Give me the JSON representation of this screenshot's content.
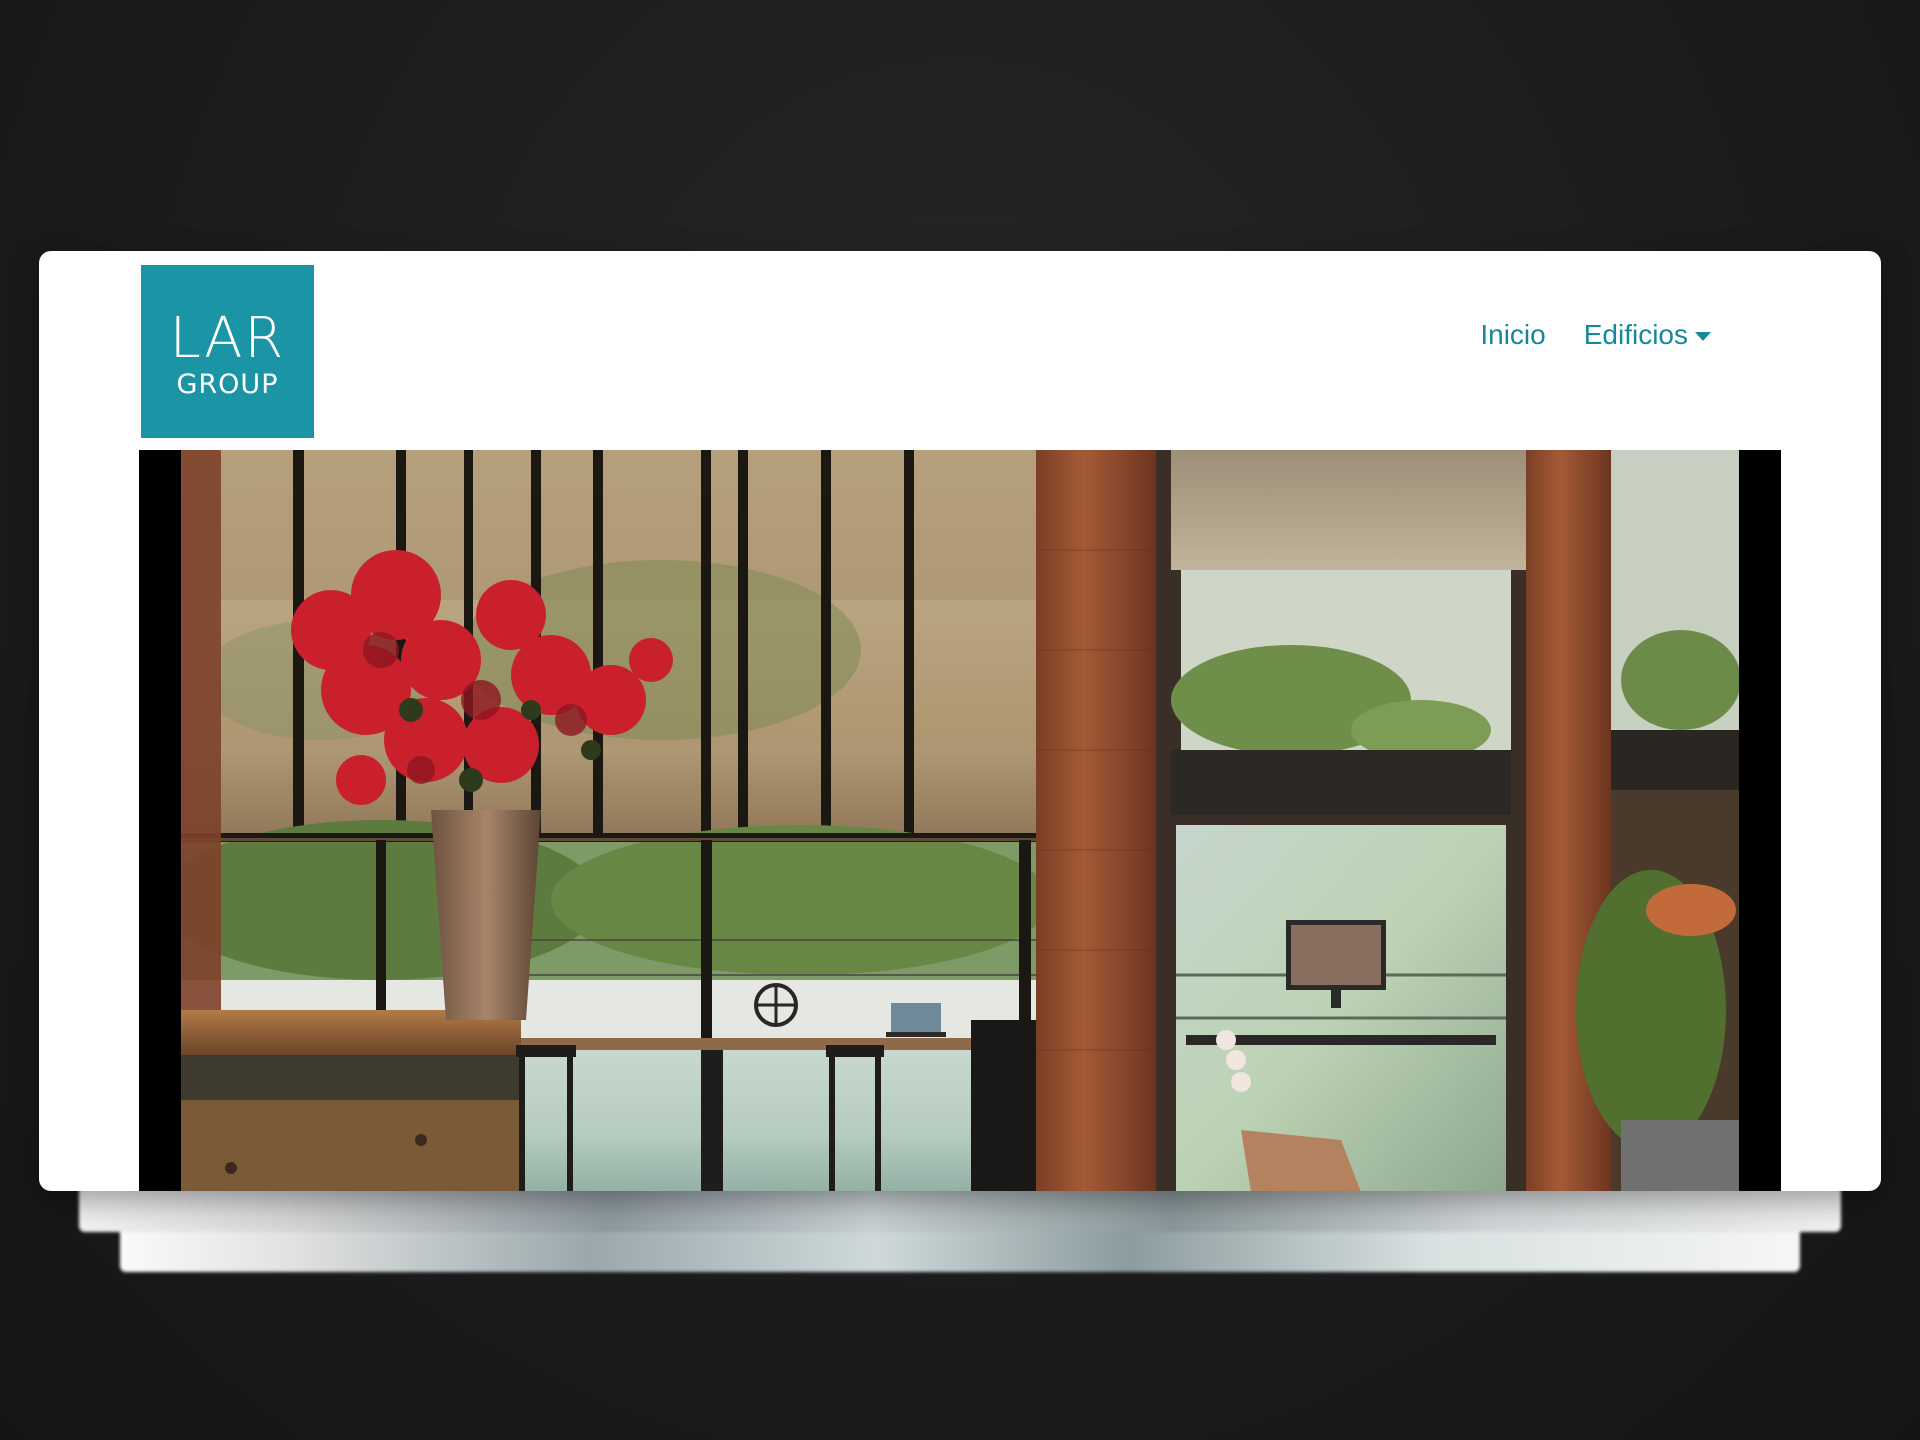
{
  "brand": {
    "logo_line1": "LAR",
    "logo_line2": "GROUP",
    "color": "#1b95a6"
  },
  "nav": {
    "items": [
      {
        "label": "Inicio"
      },
      {
        "label": "Edificios",
        "has_dropdown": true
      }
    ],
    "link_color": "#16889a"
  },
  "hero": {
    "media": "video-still-office-interior"
  }
}
